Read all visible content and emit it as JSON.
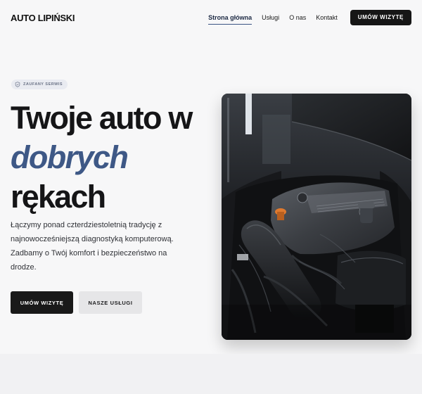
{
  "brand": {
    "name": "AUTO LIPIŃSKI"
  },
  "nav": {
    "items": [
      {
        "label": "Strona główna",
        "active": true
      },
      {
        "label": "Usługi"
      },
      {
        "label": "O nas"
      },
      {
        "label": "Kontakt"
      }
    ],
    "cta_label": "UMÓW WIZYTĘ"
  },
  "hero": {
    "badge": {
      "icon": "shield-icon",
      "label": "ZAUFANY SERWIS"
    },
    "title_line1": "Twoje auto w",
    "title_accent": "dobrych",
    "title_line3": "rękach",
    "description": "Łączymy ponad czterdziestoletnią tradycję z najnowocześniejszą diagnostyką komputerową. Zadbamy o Twój komfort i bezpieczeństwo na drodze.",
    "primary_button": "UMÓW WIZYTĘ",
    "secondary_button": "NASZE USŁUGI",
    "image": {
      "subject": "car-engine-photo"
    }
  },
  "colors": {
    "accent": "#3e5886",
    "dark": "#161616",
    "badge_bg": "#e9ebf1",
    "background": "#f7f7f8"
  }
}
